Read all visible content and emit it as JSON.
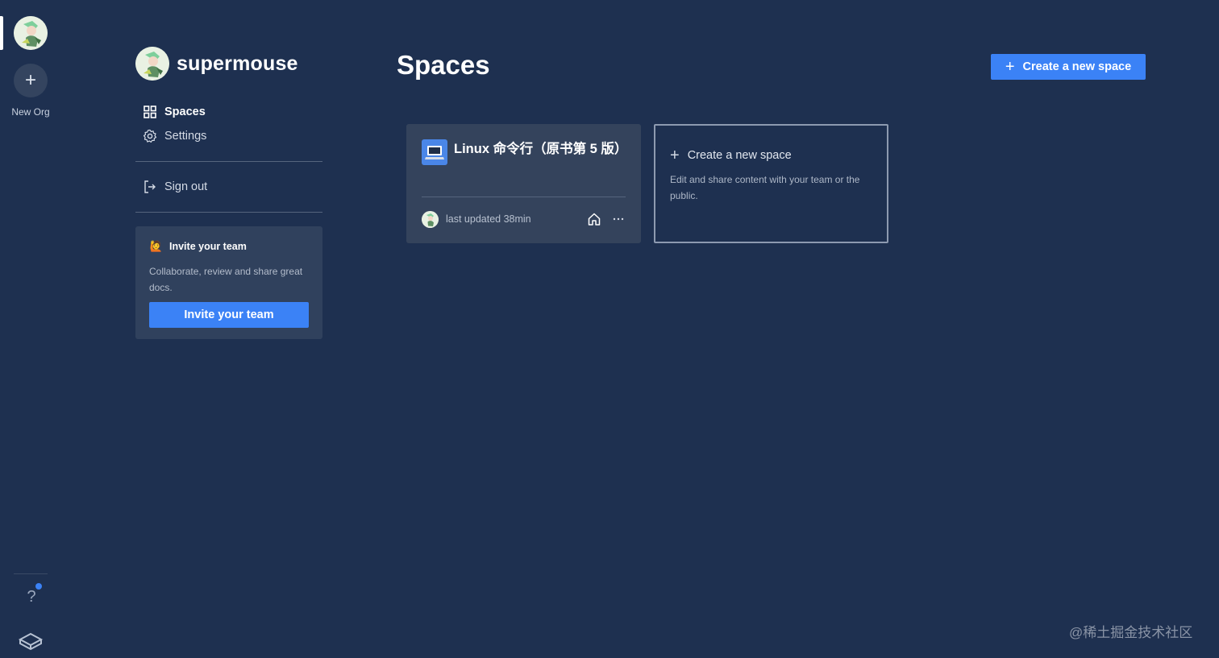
{
  "rail": {
    "new_org_label": "New Org",
    "help_label": "?"
  },
  "org": {
    "name": "supermouse"
  },
  "nav": {
    "spaces": "Spaces",
    "settings": "Settings",
    "sign_out": "Sign out"
  },
  "invite": {
    "emoji": "🙋",
    "title": "Invite your team",
    "description": "Collaborate, review and share great docs.",
    "button": "Invite your team"
  },
  "main": {
    "title": "Spaces",
    "create_button": "Create a new space"
  },
  "spaces": [
    {
      "title": "Linux 命令行（原书第 5 版）",
      "meta": "last updated 38min"
    }
  ],
  "create_space_card": {
    "title": "Create a new space",
    "description": "Edit and share content with your team or the public."
  },
  "watermark": "@稀土掘金技术社区",
  "colors": {
    "background": "#1e3050",
    "accent": "#3b82f6",
    "card": "#34435c"
  }
}
